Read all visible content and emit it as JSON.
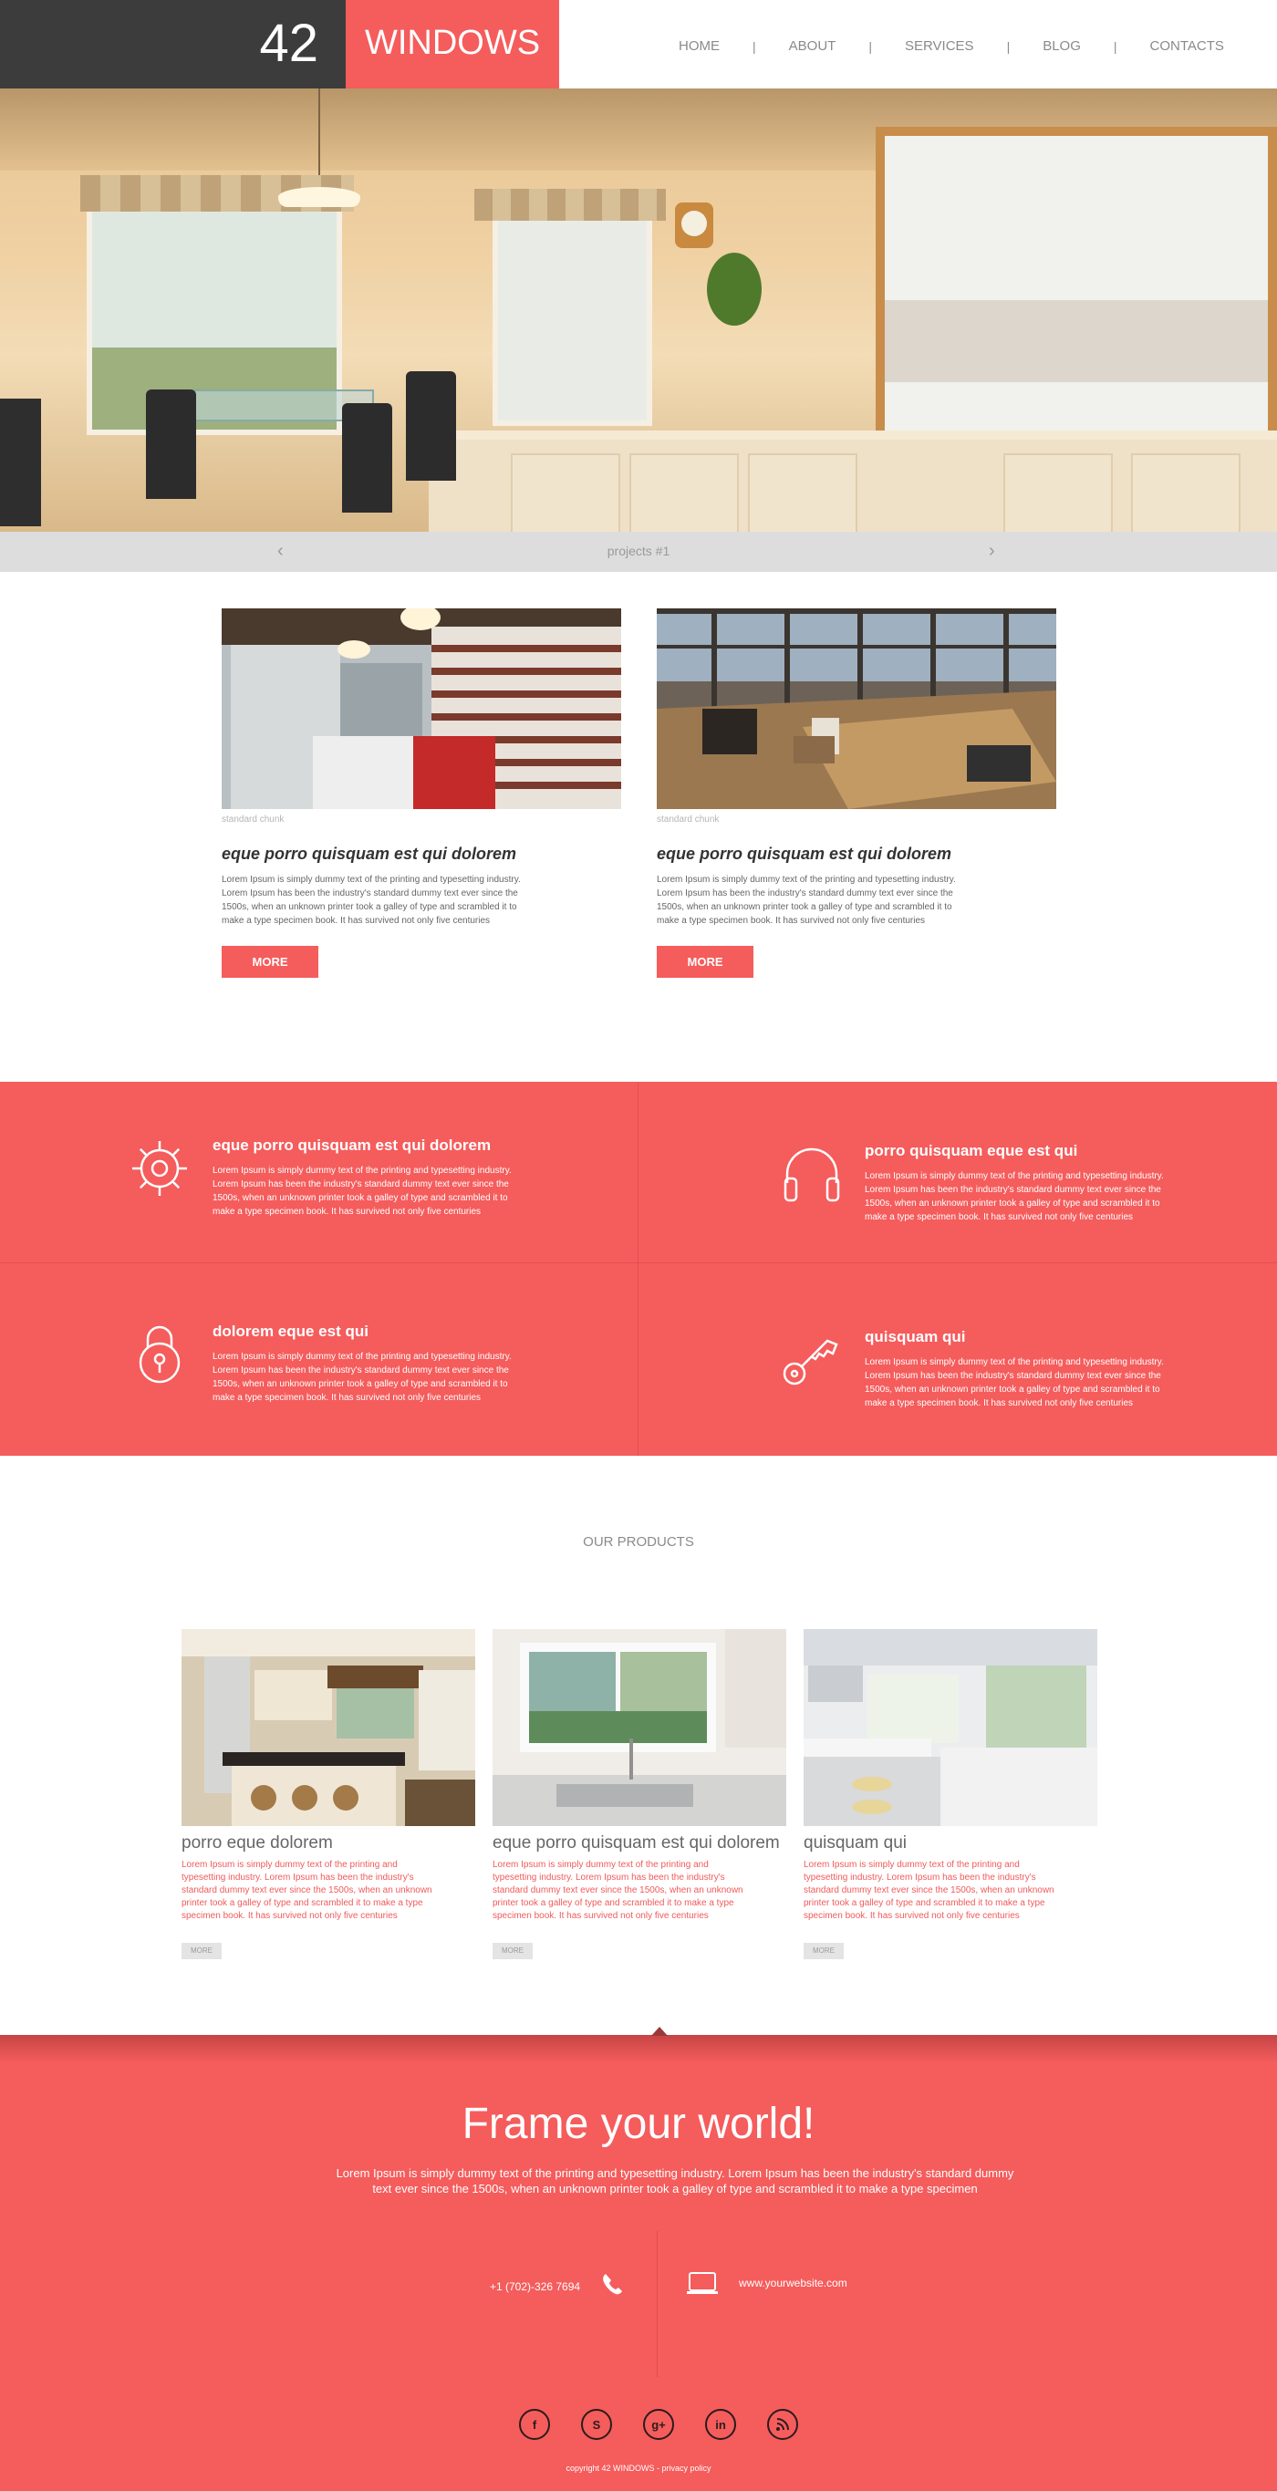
{
  "logo": {
    "number": "42",
    "word": "WINDOWS"
  },
  "nav": {
    "items": [
      "HOME",
      "ABOUT",
      "SERVICES",
      "BLOG",
      "CONTACTS"
    ],
    "separator": "|"
  },
  "slider": {
    "caption": "projects #1",
    "prev": "‹",
    "next": "›"
  },
  "articles": [
    {
      "caption": "standard chunk",
      "title": "eque porro quisquam est qui dolorem",
      "text": "Lorem Ipsum is simply dummy text of the printing and typesetting industry. Lorem Ipsum has been the industry's standard dummy text ever since the 1500s, when an unknown printer took a galley of type and scrambled it to make a type specimen book. It has survived not only five centuries",
      "button": "MORE"
    },
    {
      "caption": "standard chunk",
      "title": "eque porro quisquam est qui dolorem",
      "text": "Lorem Ipsum is simply dummy text of the printing and typesetting industry. Lorem Ipsum has been the industry's standard dummy text ever since the 1500s, when an unknown printer took a galley of type and scrambled it to make a type specimen book. It has survived not only five centuries",
      "button": "MORE"
    }
  ],
  "features": [
    {
      "icon": "gear-icon",
      "title": "eque porro quisquam est qui dolorem",
      "text": "Lorem Ipsum is simply dummy text of the printing and typesetting industry. Lorem Ipsum has been the industry's standard dummy text ever since the 1500s, when an unknown printer took a galley of type and scrambled it to make a type specimen book. It has survived not only five centuries"
    },
    {
      "icon": "headphones-icon",
      "title": "porro quisquam eque est qui",
      "text": "Lorem Ipsum is simply dummy text of the printing and typesetting industry. Lorem Ipsum has been the industry's standard dummy text ever since the 1500s, when an unknown printer took a galley of type and scrambled it to make a type specimen book. It has survived not only five centuries"
    },
    {
      "icon": "padlock-icon",
      "title": "dolorem eque est qui",
      "text": "Lorem Ipsum is simply dummy text of the printing and typesetting industry. Lorem Ipsum has been the industry's standard dummy text ever since the 1500s, when an unknown printer took a galley of type and scrambled it to make a type specimen book. It has survived not only five centuries"
    },
    {
      "icon": "key-icon",
      "title": "quisquam qui",
      "text": "Lorem Ipsum is simply dummy text of the printing and typesetting industry. Lorem Ipsum has been the industry's standard dummy text ever since the 1500s, when an unknown printer took a galley of type and scrambled it to make a type specimen book. It has survived not only five centuries"
    }
  ],
  "products": {
    "heading": "OUR PRODUCTS",
    "items": [
      {
        "title": "porro eque dolorem",
        "text": "Lorem Ipsum is simply dummy text of the printing and typesetting industry. Lorem Ipsum has been the industry's standard dummy text ever since the 1500s, when an unknown printer took a galley of type and scrambled it to make a type specimen book. It has survived not only five centuries",
        "button": "MORE"
      },
      {
        "title": "eque porro quisquam est qui dolorem",
        "text": "Lorem Ipsum is simply dummy text of the printing and typesetting industry. Lorem Ipsum has been the industry's standard dummy text ever since the 1500s, when an unknown printer took a galley of type and scrambled it to make a type specimen book. It has survived not only five centuries",
        "button": "MORE"
      },
      {
        "title": "quisquam qui",
        "text": "Lorem Ipsum is simply dummy text of the printing and typesetting industry. Lorem Ipsum has been the industry's standard dummy text ever since the 1500s, when an unknown printer took a galley of type and scrambled it to make a type specimen book. It has survived not only five centuries",
        "button": "MORE"
      }
    ]
  },
  "footer": {
    "headline": "Frame your world!",
    "lead": "Lorem Ipsum is simply dummy text of the printing and typesetting industry. Lorem Ipsum has been the industry's standard dummy text ever since the 1500s, when an unknown printer took a galley of type and scrambled it to make a type specimen",
    "phone": "+1 (702)-326 7694",
    "website": "www.yourwebsite.com",
    "socials": [
      "facebook-icon",
      "skype-icon",
      "google-plus-icon",
      "linkedin-icon",
      "rss-icon"
    ],
    "copyright": "copyright 42 WINDOWS -",
    "privacy": "privacy policy"
  },
  "colors": {
    "accent": "#f55c5c",
    "dark": "#3c3c3c",
    "nav": "#8a8a8a",
    "slider": "#dddddd"
  }
}
